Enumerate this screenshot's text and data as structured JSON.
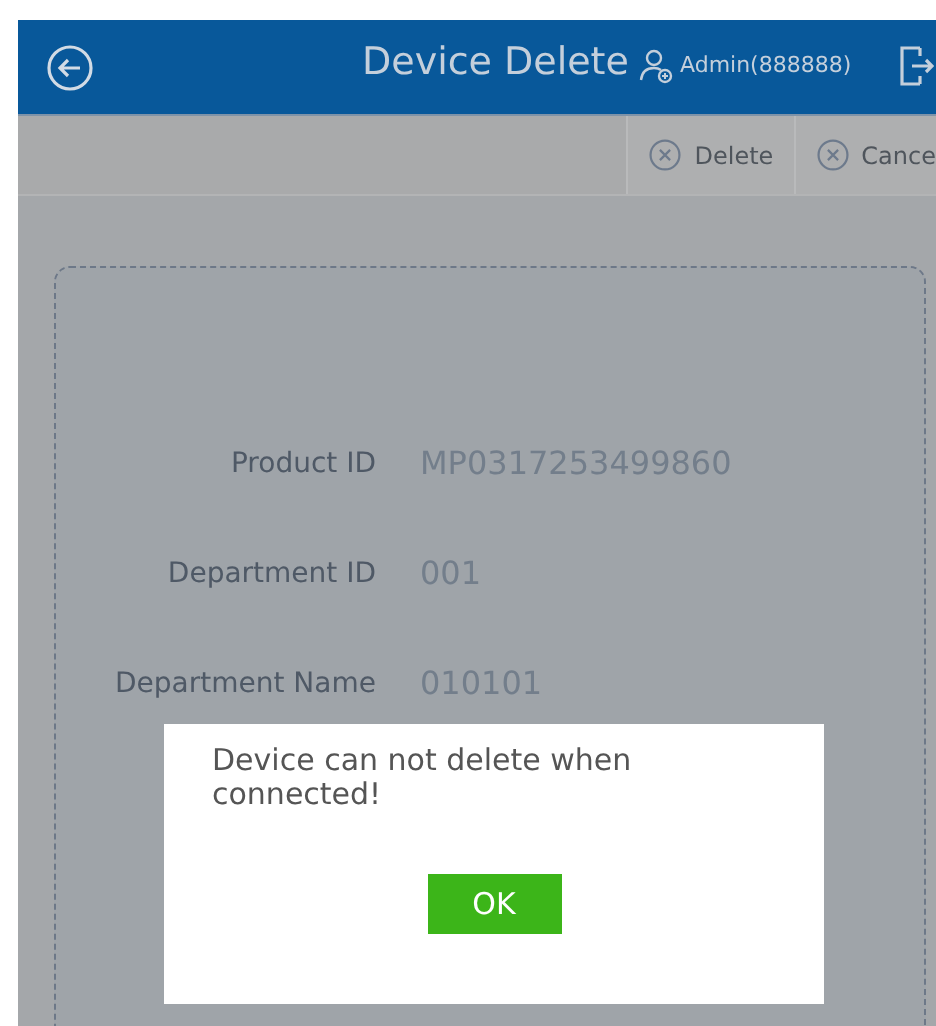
{
  "header": {
    "title": "Device Delete",
    "user": "Admin(888888)"
  },
  "toolbar": [
    {
      "label": "Delete"
    },
    {
      "label": "Cance"
    }
  ],
  "fields": [
    {
      "label": "Product ID",
      "value": "MP0317253499860"
    },
    {
      "label": "Department ID",
      "value": "001"
    },
    {
      "label": "Department Name",
      "value": "010101"
    }
  ],
  "dialog": {
    "message": "Device can not delete when connected!",
    "button": "OK"
  }
}
